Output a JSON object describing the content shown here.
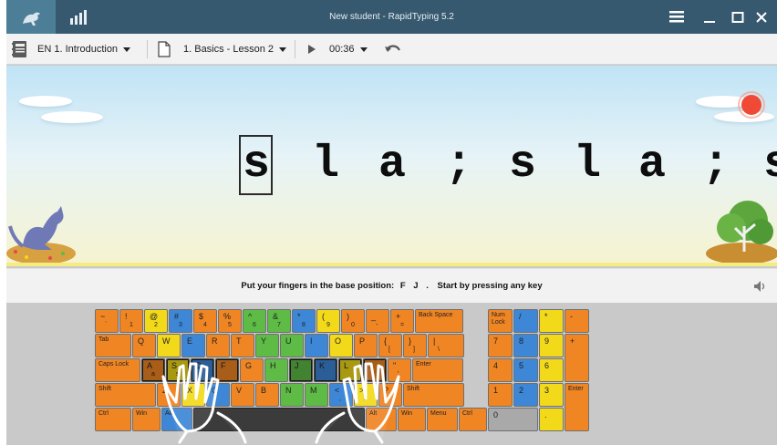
{
  "titlebar": {
    "title": "New student - RapidTyping 5.2",
    "logo_icon": "kangaroo-icon",
    "stats_icon": "statistics-icon",
    "menu_icon": "hamburger-menu-icon",
    "minimize_icon": "minimize-icon",
    "maximize_icon": "maximize-icon",
    "close_icon": "close-icon",
    "bg_color": "#37596f"
  },
  "toolbar": {
    "course": "EN 1. Introduction",
    "lesson": "1. Basics - Lesson 2",
    "time": "00:36"
  },
  "lesson_text": {
    "chars": [
      "s",
      "l",
      "a",
      ";",
      "s",
      "l",
      "a",
      ";",
      "s"
    ],
    "current_index": 0
  },
  "hint": {
    "prefix": "Put your fingers in the base position:",
    "keys": "F J .",
    "suffix": "Start by pressing any key"
  },
  "keyboard": {
    "main_rows": [
      [
        {
          "t": "~",
          "t2": "`",
          "c": "o"
        },
        {
          "t": "!",
          "t2": "1",
          "c": "o"
        },
        {
          "t": "@",
          "t2": "2",
          "c": "y"
        },
        {
          "t": "#",
          "t2": "3",
          "c": "b"
        },
        {
          "t": "$",
          "t2": "4",
          "c": "o"
        },
        {
          "t": "%",
          "t2": "5",
          "c": "o"
        },
        {
          "t": "^",
          "t2": "6",
          "c": "g"
        },
        {
          "t": "&",
          "t2": "7",
          "c": "g"
        },
        {
          "t": "*",
          "t2": "8",
          "c": "b"
        },
        {
          "t": "(",
          "t2": "9",
          "c": "y"
        },
        {
          "t": ")",
          "t2": "0",
          "c": "o"
        },
        {
          "t": "_",
          "t2": "-",
          "c": "o"
        },
        {
          "t": "+",
          "t2": "=",
          "c": "o"
        },
        {
          "t": "Back Space",
          "t2": "",
          "c": "o"
        }
      ],
      [
        {
          "t": "Tab",
          "t2": "",
          "c": "o"
        },
        {
          "t": "Q",
          "t2": "",
          "c": "o"
        },
        {
          "t": "W",
          "t2": "",
          "c": "y"
        },
        {
          "t": "E",
          "t2": "",
          "c": "b"
        },
        {
          "t": "R",
          "t2": "",
          "c": "o"
        },
        {
          "t": "T",
          "t2": "",
          "c": "o"
        },
        {
          "t": "Y",
          "t2": "",
          "c": "g"
        },
        {
          "t": "U",
          "t2": "",
          "c": "g"
        },
        {
          "t": "I",
          "t2": "",
          "c": "b"
        },
        {
          "t": "O",
          "t2": "",
          "c": "y"
        },
        {
          "t": "P",
          "t2": "",
          "c": "o"
        },
        {
          "t": "{",
          "t2": "[",
          "c": "o"
        },
        {
          "t": "}",
          "t2": "]",
          "c": "o"
        },
        {
          "t": "|",
          "t2": "\\",
          "c": "o"
        }
      ],
      [
        {
          "t": "Caps Lock",
          "t2": "",
          "c": "o"
        },
        {
          "t": "A",
          "t2": "a",
          "c": "o"
        },
        {
          "t": "S",
          "t2": "s",
          "c": "y"
        },
        {
          "t": "D",
          "t2": "",
          "c": "b"
        },
        {
          "t": "F",
          "t2": "",
          "c": "o"
        },
        {
          "t": "G",
          "t2": "",
          "c": "o"
        },
        {
          "t": "H",
          "t2": "",
          "c": "g"
        },
        {
          "t": "J",
          "t2": "",
          "c": "g"
        },
        {
          "t": "K",
          "t2": "",
          "c": "b"
        },
        {
          "t": "L",
          "t2": "",
          "c": "y"
        },
        {
          "t": ":",
          "t2": ";",
          "c": "o"
        },
        {
          "t": "\"",
          "t2": "'",
          "c": "o"
        },
        {
          "t": "Enter",
          "t2": "",
          "c": "o"
        }
      ],
      [
        {
          "t": "Shift",
          "t2": "",
          "c": "o"
        },
        {
          "t": "Z",
          "t2": "",
          "c": "o"
        },
        {
          "t": "X",
          "t2": "",
          "c": "y"
        },
        {
          "t": "C",
          "t2": "",
          "c": "b"
        },
        {
          "t": "V",
          "t2": "",
          "c": "o"
        },
        {
          "t": "B",
          "t2": "",
          "c": "o"
        },
        {
          "t": "N",
          "t2": "",
          "c": "g"
        },
        {
          "t": "M",
          "t2": "",
          "c": "g"
        },
        {
          "t": "<",
          "t2": ",",
          "c": "b"
        },
        {
          "t": ">",
          "t2": ".",
          "c": "y"
        },
        {
          "t": "?",
          "t2": "/",
          "c": "o"
        },
        {
          "t": "Shift",
          "t2": "",
          "c": "o"
        }
      ],
      [
        {
          "t": "Ctrl",
          "t2": "",
          "c": "o"
        },
        {
          "t": "Win",
          "t2": "",
          "c": "o"
        },
        {
          "t": "Alt",
          "t2": "",
          "c": "b"
        },
        {
          "t": "",
          "t2": "",
          "c": "dk"
        },
        {
          "t": "Alt",
          "t2": "",
          "c": "o"
        },
        {
          "t": "Win",
          "t2": "",
          "c": "o"
        },
        {
          "t": "Menu",
          "t2": "",
          "c": "o"
        },
        {
          "t": "Ctrl",
          "t2": "",
          "c": "o"
        }
      ]
    ],
    "numpad": [
      {
        "t": "Num Lock",
        "c": "o"
      },
      {
        "t": "/",
        "c": "b"
      },
      {
        "t": "*",
        "c": "y"
      },
      {
        "t": "-",
        "c": "o"
      },
      {
        "t": "7",
        "c": "o"
      },
      {
        "t": "8",
        "c": "b"
      },
      {
        "t": "9",
        "c": "y"
      },
      {
        "t": "+",
        "c": "o"
      },
      {
        "t": "4",
        "c": "o"
      },
      {
        "t": "5",
        "c": "b"
      },
      {
        "t": "6",
        "c": "y"
      },
      {
        "t": "1",
        "c": "o"
      },
      {
        "t": "2",
        "c": "b"
      },
      {
        "t": "3",
        "c": "y"
      },
      {
        "t": "Enter",
        "c": "o"
      },
      {
        "t": "0",
        "c": "gr"
      },
      {
        "t": ".",
        "c": "y"
      }
    ]
  },
  "colors": {
    "orange": "#f08524",
    "yellow": "#f2d91a",
    "blue": "#3d87d6",
    "green": "#5dbb46"
  }
}
